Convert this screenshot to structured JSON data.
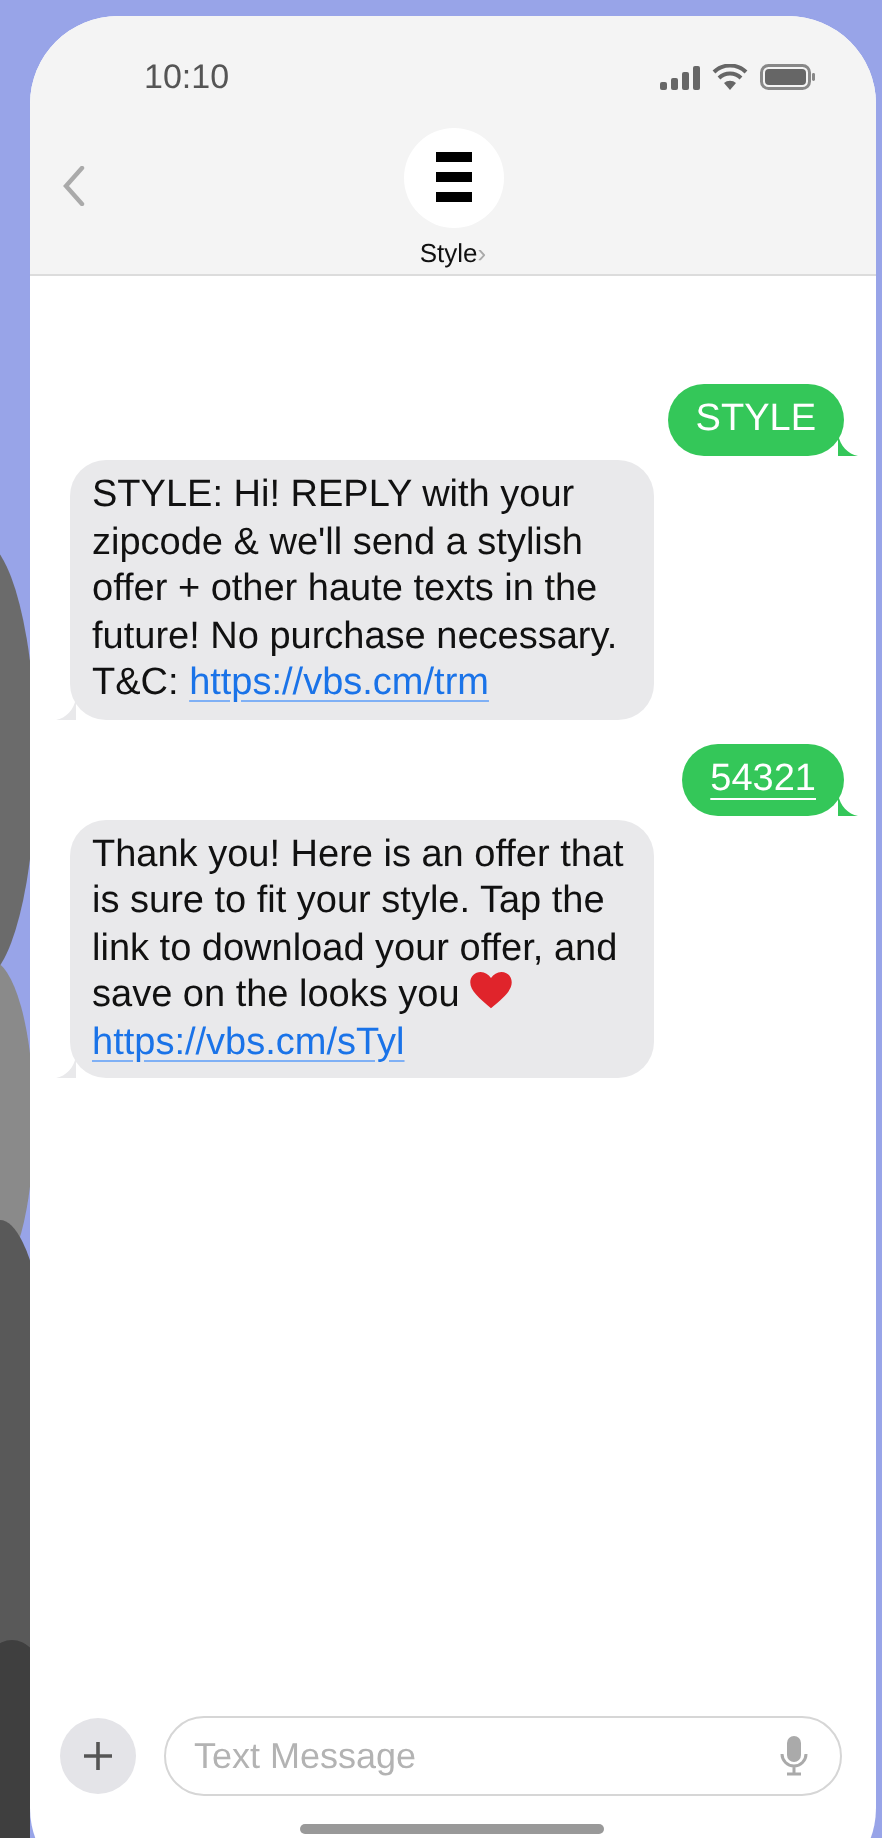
{
  "status_bar": {
    "time": "10:10"
  },
  "header": {
    "contact_name": "Style",
    "chevron": "›"
  },
  "messages": [
    {
      "kind": "sent",
      "segments": [
        {
          "kind": "text",
          "text": "STYLE"
        }
      ]
    },
    {
      "kind": "received",
      "segments": [
        {
          "kind": "text",
          "text": "STYLE: Hi! REPLY with your zipcode & we'll send a stylish offer + other haute texts in the future! No purchase necessary. T&C: "
        },
        {
          "kind": "link",
          "text": "https://vbs.cm/trm"
        }
      ]
    },
    {
      "kind": "sent",
      "segments": [
        {
          "kind": "data",
          "text": "54321"
        }
      ]
    },
    {
      "kind": "received",
      "segments": [
        {
          "kind": "text",
          "text": "Thank you! Here is an offer that is sure to fit your style. Tap the link to download your offer, and save on the looks you "
        },
        {
          "kind": "heart"
        },
        {
          "kind": "link",
          "text": "https://vbs.cm/sTyl"
        }
      ]
    }
  ],
  "composer": {
    "placeholder": "Text Message"
  }
}
